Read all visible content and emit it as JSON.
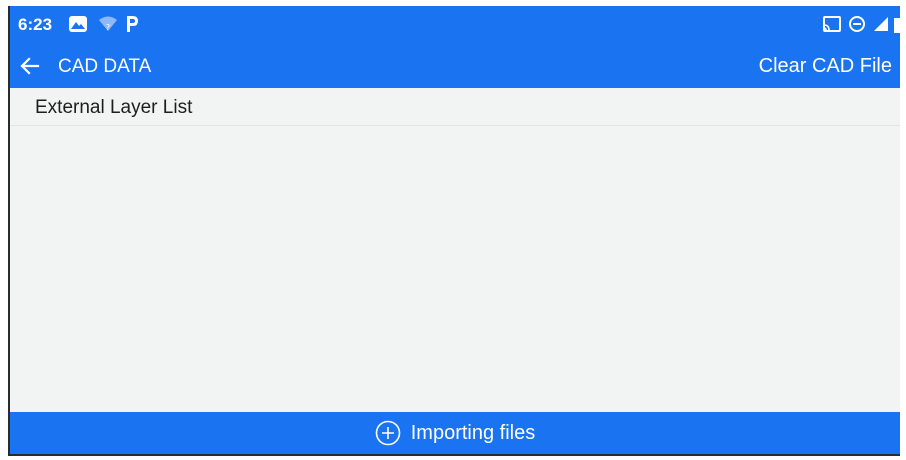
{
  "status_bar": {
    "time": "6:23",
    "left_icons": [
      "gallery-icon",
      "wifi-icon",
      "parking-icon"
    ],
    "right_icons": [
      "cast-icon",
      "do-not-disturb-icon",
      "signal-icon",
      "battery-icon"
    ]
  },
  "toolbar": {
    "back_icon": "arrow-left-icon",
    "title": "CAD DATA",
    "clear_label": "Clear CAD File"
  },
  "list": {
    "header": "External Layer List",
    "items": []
  },
  "bottom_bar": {
    "icon": "plus-circle-icon",
    "label": "Importing files"
  },
  "colors": {
    "primary": "#1a73f0",
    "background": "#f2f3f3",
    "text": "#1e1e1e"
  }
}
